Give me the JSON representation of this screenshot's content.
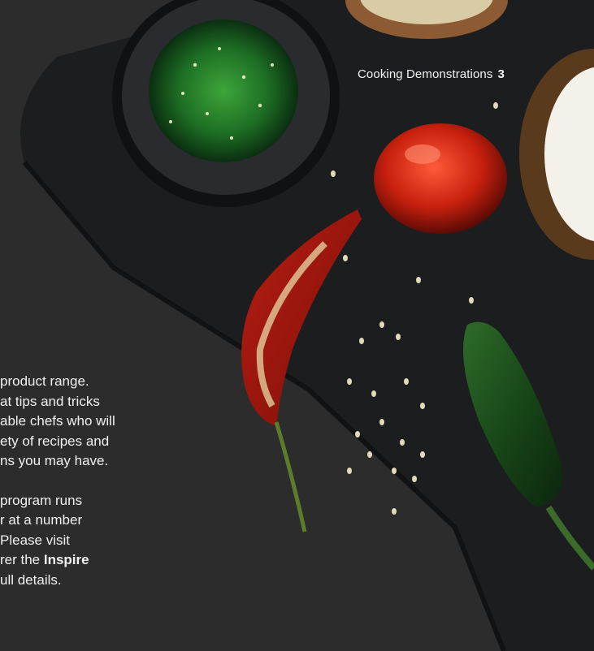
{
  "header": {
    "title": "Cooking Demonstrations",
    "page_number": "3"
  },
  "body": {
    "paragraph1": [
      "product range.",
      "at tips and tricks",
      "able chefs who will",
      "ety of recipes and",
      "ns you may have."
    ],
    "paragraph2": [
      "program runs",
      "r at a number",
      "Please visit",
      "rer the ",
      "Inspire",
      "ull details."
    ]
  },
  "colors": {
    "background": "#2c2c2d",
    "board": "#1c1d1f",
    "text": "#f0f0f0"
  }
}
